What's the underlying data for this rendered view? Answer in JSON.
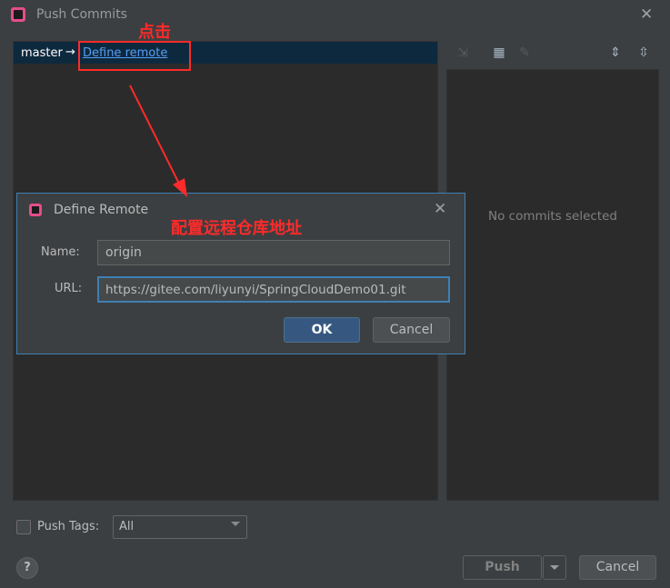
{
  "window": {
    "title": "Push Commits"
  },
  "tree": {
    "branch": "master",
    "arrow": "→",
    "define_remote_link": "Define remote"
  },
  "details": {
    "empty_text": "No commits selected"
  },
  "toolbar": {
    "icons": [
      "fetch-icon",
      "group-by-icon",
      "edit-icon",
      "expand-all-icon",
      "collapse-all-icon"
    ]
  },
  "bottom": {
    "push_tags_label": "Push Tags:",
    "tags_select_value": "All",
    "push_label": "Push",
    "cancel_label": "Cancel",
    "help_glyph": "?"
  },
  "dialog": {
    "title": "Define Remote",
    "name_label": "Name:",
    "name_value": "origin",
    "url_label": "URL:",
    "url_value": "https://gitee.com/liyunyi/SpringCloudDemo01.git",
    "ok_label": "OK",
    "cancel_label": "Cancel"
  },
  "annotations": {
    "click_text": "点击",
    "config_text": "配置远程仓库地址",
    "color": "#ff2a2a"
  },
  "colors": {
    "accent": "#3d80b4",
    "link": "#589df6",
    "selection": "#0d293e",
    "background": "#3c3f41",
    "panel": "#2b2b2b"
  }
}
